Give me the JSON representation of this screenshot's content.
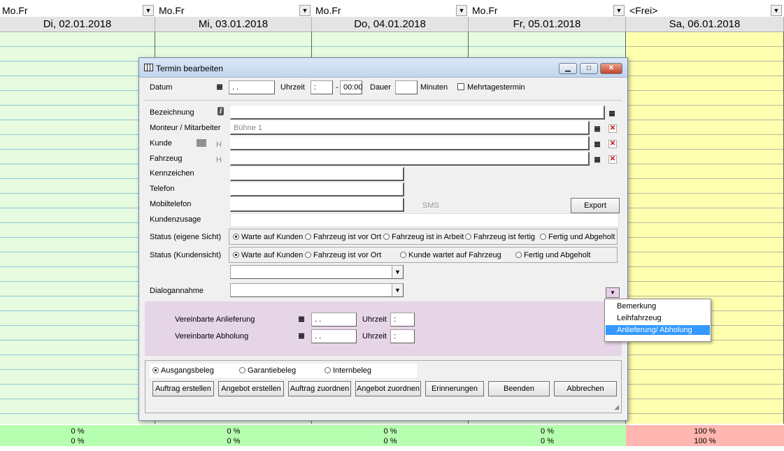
{
  "schedule": {
    "columns": [
      {
        "select": "Mo.Fr",
        "date": "Di, 02.01.2018",
        "pct1": "0 %",
        "pct2": "0 %"
      },
      {
        "select": "Mo.Fr",
        "date": "Mi, 03.01.2018",
        "pct1": "0 %",
        "pct2": "0 %"
      },
      {
        "select": "Mo.Fr",
        "date": "Do, 04.01.2018",
        "pct1": "0 %",
        "pct2": "0 %"
      },
      {
        "select": "Mo.Fr",
        "date": "Fr, 05.01.2018",
        "pct1": "0 %",
        "pct2": "0 %"
      },
      {
        "select": "<Frei>",
        "date": "Sa, 06.01.2018",
        "pct1": "100 %",
        "pct2": "100 %"
      }
    ]
  },
  "dialog": {
    "title": "Termin bearbeiten",
    "datum_label": "Datum",
    "datum_value": ". .",
    "uhrzeit_label": "Uhrzeit",
    "uhrzeit_value": ":",
    "uhrzeit_dash": "-",
    "uhrzeit_end": "00:00",
    "dauer_label": "Dauer",
    "minuten_label": "Minuten",
    "mehrtages_label": "Mehrtagestermin",
    "bezeichnung_label": "Bezeichnung",
    "monteur_label": "Monteur / Mitarbeiter",
    "monteur_value": "Bühne 1",
    "kunde_label": "Kunde",
    "fahrzeug_label": "Fahrzeug",
    "h_marker": "H",
    "kennzeichen_label": "Kennzeichen",
    "telefon_label": "Telefon",
    "mobil_label": "Mobiltelefon",
    "sms_label": "SMS",
    "export_label": "Export",
    "kundenzusage_label": "Kundenzusage",
    "status_eigen_label": "Status (eigene Sicht)",
    "status_eigen_options": [
      "Warte auf Kunden",
      "Fahrzeug ist vor Ort",
      "Fahrzeug ist in Arbeit",
      "Fahrzeug ist fertig",
      "Fertig und Abgeholt"
    ],
    "status_kunde_label": "Status (Kundensicht)",
    "status_kunde_options": [
      "Warte auf Kunden",
      "Fahrzeug ist vor Ort",
      "Kunde wartet auf Fahrzeug",
      "Fertig und Abgeholt"
    ],
    "dialogannahme_label": "Dialogannahme",
    "anlieferung_label": "Vereinbarte Anlieferung",
    "abholung_label": "Vereinbarte Abholung",
    "date_placeholder": ". .",
    "time_placeholder": ":",
    "beleg_options": [
      "Ausgangsbeleg",
      "Garantiebeleg",
      "Internbeleg"
    ],
    "buttons": [
      "Auftrag erstellen",
      "Angebot erstellen",
      "Auftrag zuordnen",
      "Angebot zuordnen",
      "Erinnerungen",
      "Beenden",
      "Abbrechen"
    ]
  },
  "popup": {
    "items": [
      "Bemerkung",
      "Leihfahrzeug",
      "Anlieferung/ Abholung"
    ],
    "selected_index": 2
  },
  "colors": {
    "day_green": "#e6fbdf",
    "day_yellow": "#ffffb0",
    "footer_green": "#b7ffb0",
    "footer_red": "#ffb6b0",
    "section_purple": "#e6d5e6",
    "selection_blue": "#3399ff"
  }
}
